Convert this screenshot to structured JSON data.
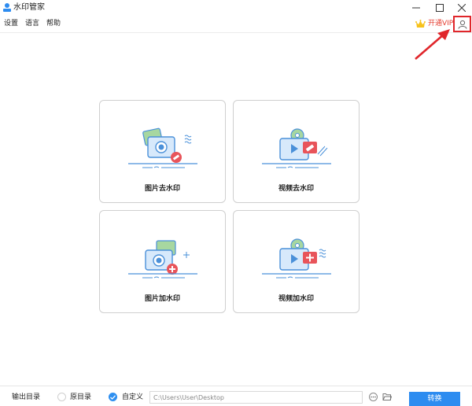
{
  "window": {
    "title": "水印管家",
    "app_icon": "user-stamp-icon",
    "controls": [
      "minimize-icon",
      "maximize-icon",
      "close-icon"
    ]
  },
  "menu": {
    "items": [
      "设置",
      "语言",
      "帮助"
    ],
    "vip": {
      "label": "开通VIP",
      "icon": "crown-icon"
    },
    "user_icon": "user-icon"
  },
  "features": [
    {
      "label": "图片去水印",
      "icon": "photo-remove-watermark-icon"
    },
    {
      "label": "视频去水印",
      "icon": "video-remove-watermark-icon"
    },
    {
      "label": "图片加水印",
      "icon": "photo-add-watermark-icon"
    },
    {
      "label": "视频加水印",
      "icon": "video-add-watermark-icon"
    }
  ],
  "output": {
    "label": "输出目录",
    "options": [
      {
        "label": "原目录",
        "selected": false
      },
      {
        "label": "自定义",
        "selected": true
      }
    ],
    "path": "C:\\Users\\User\\Desktop",
    "more_icon": "ellipsis-icon",
    "folder_icon": "folder-icon",
    "convert_label": "转换"
  },
  "colors": {
    "accent": "#2d8cf0",
    "vip_red": "#e53c2f",
    "annotation_red": "#e0262b",
    "icon_blue": "#4a90d9",
    "icon_red": "#e8545a"
  }
}
